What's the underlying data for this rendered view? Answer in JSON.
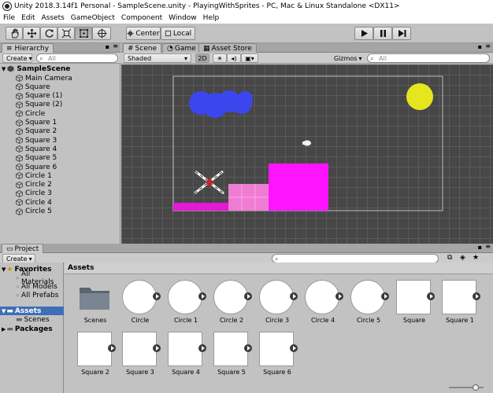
{
  "window": {
    "title": "Unity 2018.3.14f1 Personal - SampleScene.unity - PlayingWithSprites - PC, Mac & Linux Standalone <DX11>"
  },
  "menu": [
    "File",
    "Edit",
    "Assets",
    "GameObject",
    "Component",
    "Window",
    "Help"
  ],
  "toolbar": {
    "tools": [
      "hand-tool",
      "move-tool",
      "rotate-tool",
      "scale-tool",
      "rect-tool",
      "transform-tool"
    ],
    "active_tool": "rect-tool",
    "pivot_label": "Center",
    "space_label": "Local",
    "play_icons": [
      "play-icon",
      "pause-icon",
      "step-icon"
    ]
  },
  "hierarchy": {
    "tab": "Hierarchy",
    "create_label": "Create",
    "search_placeholder": "All",
    "scene": "SampleScene",
    "items": [
      "Main Camera",
      "Square",
      "Square (1)",
      "Square (2)",
      "Circle",
      "Square 1",
      "Square 2",
      "Square 3",
      "Square 4",
      "Square 5",
      "Square 6",
      "Circle 1",
      "Circle 2",
      "Circle 3",
      "Circle 4",
      "Circle 5"
    ]
  },
  "scene_view": {
    "tabs": [
      "Scene",
      "Game",
      "Asset Store"
    ],
    "active_tab": "Scene",
    "shading": "Shaded",
    "mode_2d": "2D",
    "gizmos_label": "Gizmos",
    "search_placeholder": "All",
    "colors": {
      "cloud": "#3c46ee",
      "sun": "#e6e61e",
      "block": "#ff14ff",
      "pink": "#ef7cd3",
      "ground": "#e519d6"
    }
  },
  "project": {
    "tab": "Project",
    "create_label": "Create",
    "favorites_label": "Favorites",
    "favorites": [
      "All Materials",
      "All Models",
      "All Prefabs"
    ],
    "assets_label": "Assets",
    "assets_children": [
      "Scenes"
    ],
    "packages_label": "Packages",
    "breadcrumb": "Assets",
    "items_row1": [
      {
        "name": "Scenes",
        "kind": "folder"
      },
      {
        "name": "Circle",
        "kind": "circle"
      },
      {
        "name": "Circle 1",
        "kind": "circle"
      },
      {
        "name": "Circle 2",
        "kind": "circle"
      },
      {
        "name": "Circle 3",
        "kind": "circle"
      },
      {
        "name": "Circle 4",
        "kind": "circle"
      },
      {
        "name": "Circle 5",
        "kind": "circle"
      },
      {
        "name": "Square",
        "kind": "square"
      },
      {
        "name": "Square 1",
        "kind": "square"
      }
    ],
    "items_row2": [
      {
        "name": "Square 2",
        "kind": "square"
      },
      {
        "name": "Square 3",
        "kind": "square"
      },
      {
        "name": "Square 4",
        "kind": "square"
      },
      {
        "name": "Square 5",
        "kind": "square"
      },
      {
        "name": "Square 6",
        "kind": "square"
      }
    ]
  }
}
